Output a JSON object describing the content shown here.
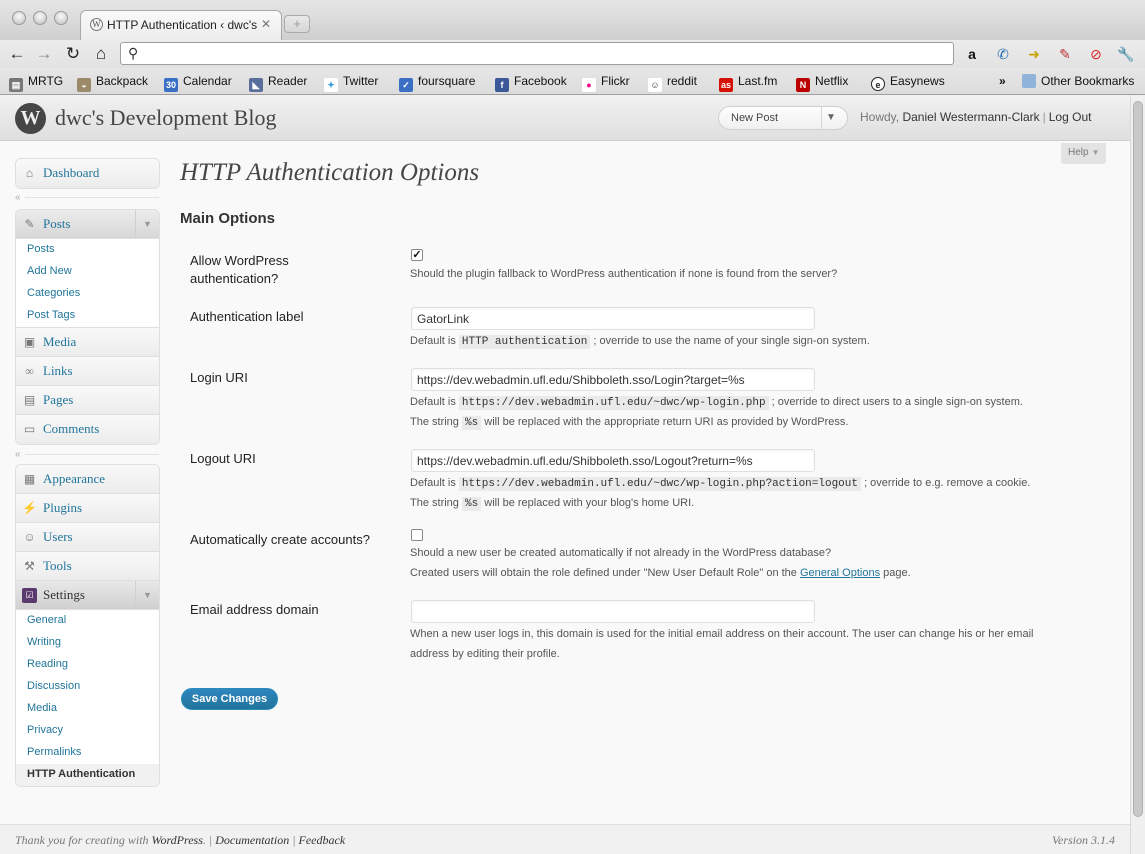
{
  "browser": {
    "tab_title": "HTTP Authentication ‹ dwc's",
    "bookmarks": [
      {
        "label": "MRTG",
        "icon": "chart-icon"
      },
      {
        "label": "Backpack",
        "icon": "backpack-icon"
      },
      {
        "label": "Calendar",
        "icon": "calendar-icon"
      },
      {
        "label": "Reader",
        "icon": "rss-icon"
      },
      {
        "label": "Twitter",
        "icon": "twitter-icon"
      },
      {
        "label": "foursquare",
        "icon": "foursquare-icon"
      },
      {
        "label": "Facebook",
        "icon": "facebook-icon"
      },
      {
        "label": "Flickr",
        "icon": "flickr-icon"
      },
      {
        "label": "reddit",
        "icon": "reddit-icon"
      },
      {
        "label": "Last.fm",
        "icon": "lastfm-icon"
      },
      {
        "label": "Netflix",
        "icon": "netflix-icon"
      },
      {
        "label": "Easynews",
        "icon": "easynews-icon"
      }
    ],
    "bookmarks_overflow": "»",
    "other_bookmarks": "Other Bookmarks"
  },
  "header": {
    "site_name": "dwc's Development Blog",
    "favorite_action": "New Post",
    "howdy": "Howdy,",
    "user_name": "Daniel Westermann-Clark",
    "logout": "Log Out",
    "help": "Help"
  },
  "sidebar": {
    "dashboard": "Dashboard",
    "posts": "Posts",
    "posts_sub": [
      "Posts",
      "Add New",
      "Categories",
      "Post Tags"
    ],
    "media": "Media",
    "links": "Links",
    "pages": "Pages",
    "comments": "Comments",
    "appearance": "Appearance",
    "plugins": "Plugins",
    "users": "Users",
    "tools": "Tools",
    "settings": "Settings",
    "settings_sub": [
      "General",
      "Writing",
      "Reading",
      "Discussion",
      "Media",
      "Privacy",
      "Permalinks",
      "HTTP Authentication"
    ]
  },
  "main": {
    "title": "HTTP Authentication Options",
    "section": "Main Options",
    "allow_wp": {
      "label": "Allow WordPress authentication?",
      "checked": true,
      "desc": "Should the plugin fallback to WordPress authentication if none is found from the server?"
    },
    "auth_label": {
      "label": "Authentication label",
      "value": "GatorLink",
      "desc_pre": "Default is",
      "desc_code": "HTTP authentication",
      "desc_post": "; override to use the name of your single sign-on system."
    },
    "login_uri": {
      "label": "Login URI",
      "value": "https://dev.webadmin.ufl.edu/Shibboleth.sso/Login?target=%s",
      "desc_pre": "Default is",
      "desc_code": "https://dev.webadmin.ufl.edu/~dwc/wp-login.php",
      "desc_post": "; override to direct users to a single sign-on system.",
      "desc2_pre": "The string",
      "desc2_code": "%s",
      "desc2_post": "will be replaced with the appropriate return URI as provided by WordPress."
    },
    "logout_uri": {
      "label": "Logout URI",
      "value": "https://dev.webadmin.ufl.edu/Shibboleth.sso/Logout?return=%s",
      "desc_pre": "Default is",
      "desc_code": "https://dev.webadmin.ufl.edu/~dwc/wp-login.php?action=logout",
      "desc_post": "; override to e.g. remove a cookie.",
      "desc2_pre": "The string",
      "desc2_code": "%s",
      "desc2_post": "will be replaced with your blog's home URI."
    },
    "auto_create": {
      "label": "Automatically create accounts?",
      "checked": false,
      "desc": "Should a new user be created automatically if not already in the WordPress database?",
      "desc2_pre": "Created users will obtain the role defined under \"New User Default Role\" on the",
      "desc2_link": "General Options",
      "desc2_post": "page."
    },
    "email_domain": {
      "label": "Email address domain",
      "value": "",
      "desc": "When a new user logs in, this domain is used for the initial email address on their account. The user can change his or her email",
      "desc2": "address by editing their profile."
    },
    "save_button": "Save Changes"
  },
  "footer": {
    "thanks_pre": "Thank you for creating with",
    "wordpress": "WordPress",
    "documentation": "Documentation",
    "feedback": "Feedback",
    "version": "Version 3.1.4"
  }
}
